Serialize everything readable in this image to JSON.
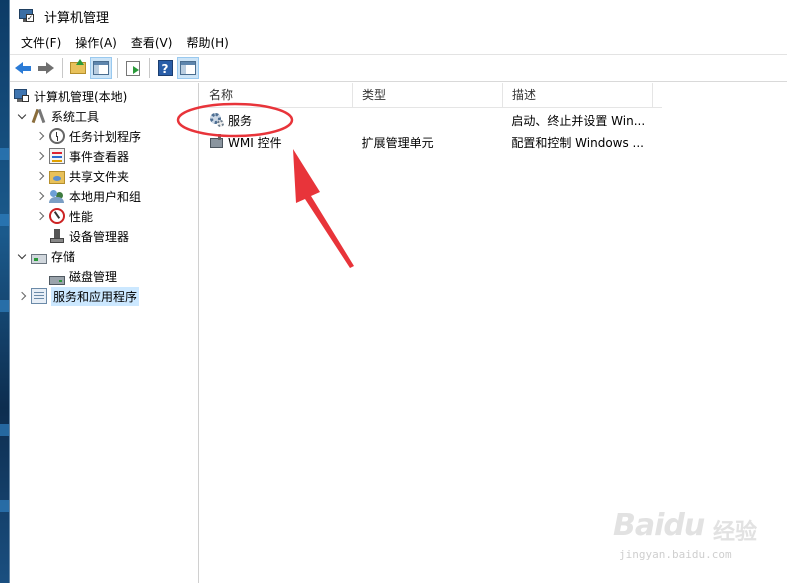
{
  "window": {
    "title": "计算机管理"
  },
  "menu": [
    "文件(F)",
    "操作(A)",
    "查看(V)",
    "帮助(H)"
  ],
  "toolbar": {
    "buttons": [
      "back-arrow-icon",
      "forward-arrow-icon",
      "up-folder-icon",
      "show-hide-tree-icon",
      "export-list-icon",
      "help-icon",
      "show-hide-action-pane-icon"
    ],
    "help_glyph": "?"
  },
  "tree": {
    "root": "计算机管理(本地)",
    "items": [
      {
        "label": "系统工具",
        "level": 1,
        "expander": "expanded",
        "icon": "tools-icon"
      },
      {
        "label": "任务计划程序",
        "level": 2,
        "expander": "collapsed",
        "icon": "clock-icon"
      },
      {
        "label": "事件查看器",
        "level": 2,
        "expander": "collapsed",
        "icon": "event-viewer-icon"
      },
      {
        "label": "共享文件夹",
        "level": 2,
        "expander": "collapsed",
        "icon": "shared-folder-icon"
      },
      {
        "label": "本地用户和组",
        "level": 2,
        "expander": "collapsed",
        "icon": "users-icon"
      },
      {
        "label": "性能",
        "level": 2,
        "expander": "collapsed",
        "icon": "performance-icon"
      },
      {
        "label": "设备管理器",
        "level": 2,
        "expander": "none",
        "icon": "device-manager-icon"
      },
      {
        "label": "存储",
        "level": 1,
        "expander": "expanded",
        "icon": "storage-icon"
      },
      {
        "label": "磁盘管理",
        "level": 2,
        "expander": "none",
        "icon": "disk-icon"
      },
      {
        "label": "服务和应用程序",
        "level": 1,
        "expander": "collapsed",
        "icon": "services-apps-icon",
        "selected": true
      }
    ]
  },
  "list": {
    "columns": [
      "名称",
      "类型",
      "描述"
    ],
    "rows": [
      {
        "name": "服务",
        "type": "",
        "description": "启动、终止并设置 Win...",
        "icon": "gear-icon"
      },
      {
        "name": "WMI 控件",
        "type": "扩展管理单元",
        "description": "配置和控制 Windows ...",
        "icon": "wmi-icon"
      }
    ]
  },
  "annotation": {
    "color": "#e8343a"
  },
  "watermark": {
    "brand": "Bai",
    "paw": "du",
    "cn": "经验",
    "url": "jingyan.baidu.com"
  }
}
